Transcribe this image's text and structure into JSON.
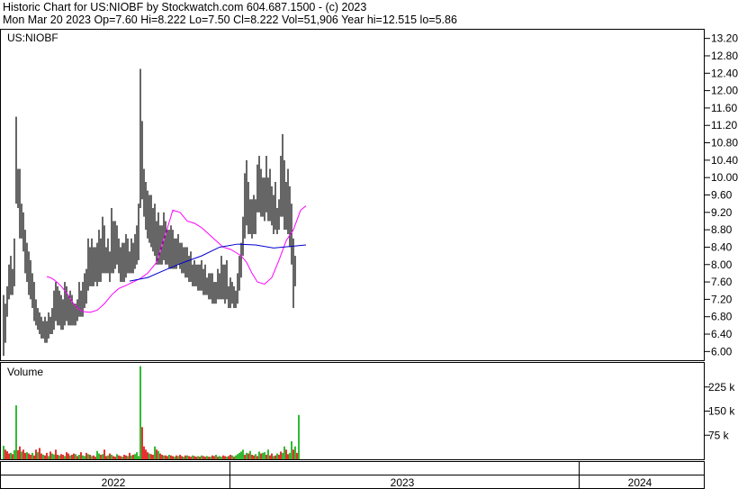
{
  "header": {
    "line1": "Historic Chart for US:NIOBF by Stockwatch.com 604.687.1500 - (c) 2023",
    "line2": "Mon Mar 20 2023   Op=7.60  Hi=8.222  Lo=7.50  Cl=8.222  Vol=51,906  Year hi=12.515  lo=5.86"
  },
  "colors": {
    "price": "#000000",
    "ma_short": "#ff00ff",
    "ma_long": "#0000cc",
    "vol_up": "#00aa00",
    "vol_down": "#dd0000",
    "frame": "#000000",
    "grid": "#c8c8c8"
  },
  "chart_data": [
    {
      "type": "line",
      "panel": "price",
      "label": "US:NIOBF",
      "yticks": [
        "13.20",
        "12.80",
        "12.40",
        "12.00",
        "11.60",
        "11.20",
        "10.80",
        "10.40",
        "10.00",
        "9.60",
        "9.20",
        "8.80",
        "8.40",
        "8.00",
        "7.60",
        "7.20",
        "6.80",
        "6.40",
        "6.00"
      ],
      "ylim": [
        5.8,
        13.4
      ],
      "grid": true,
      "series": [
        {
          "role": "price-high-low-bars",
          "x": [
            0,
            2,
            4,
            6,
            8,
            10,
            12,
            14,
            16,
            18,
            20,
            22,
            24,
            26,
            28,
            30,
            32,
            34,
            36,
            38,
            40,
            42,
            44,
            46,
            48,
            50,
            52,
            54,
            56,
            58,
            60,
            62,
            64,
            66,
            68,
            70,
            72,
            74,
            76,
            78,
            80,
            82,
            84,
            86,
            88,
            90,
            92,
            94,
            96,
            98,
            100,
            102,
            104,
            106,
            108,
            110,
            112,
            114,
            116,
            118,
            120,
            122,
            124,
            126,
            128,
            130,
            132,
            134,
            136,
            138,
            140,
            142,
            144,
            146,
            148,
            150,
            152,
            154,
            156,
            158,
            160,
            162,
            164,
            166,
            168,
            170,
            172,
            174,
            176,
            178,
            180,
            182,
            184,
            186,
            188,
            190,
            192,
            194,
            196,
            198,
            200,
            202,
            204,
            206,
            208,
            210,
            212,
            214,
            216,
            218,
            220,
            222,
            224,
            226,
            228,
            230,
            232,
            234,
            236,
            238,
            240,
            242,
            244,
            246,
            248,
            250,
            252,
            254,
            256,
            258,
            260,
            262,
            264,
            266,
            268,
            270,
            272,
            274,
            276,
            278,
            280,
            282,
            284,
            286,
            288,
            290,
            292,
            294,
            296,
            298,
            300,
            302,
            304,
            306,
            308,
            310,
            312,
            314,
            316,
            318,
            320,
            322,
            324,
            326,
            328,
            330,
            332,
            334,
            336
          ],
          "high": [
            7.3,
            7.1,
            7.5,
            8.0,
            8.2,
            7.9,
            8.6,
            11.4,
            10.2,
            10.2,
            9.4,
            9.2,
            8.8,
            8.5,
            8.3,
            8.1,
            7.8,
            7.6,
            7.2,
            7.0,
            6.9,
            6.8,
            6.7,
            6.8,
            6.7,
            6.9,
            6.8,
            7.0,
            7.4,
            7.6,
            7.5,
            7.4,
            7.3,
            7.2,
            7.6,
            7.5,
            7.3,
            7.4,
            7.3,
            7.1,
            7.1,
            7.2,
            7.6,
            7.4,
            7.6,
            7.8,
            7.9,
            8.6,
            8.4,
            8.6,
            8.4,
            8.4,
            8.5,
            8.8,
            8.6,
            9.1,
            8.9,
            8.4,
            8.6,
            8.3,
            9.3,
            9.0,
            9.0,
            8.9,
            8.6,
            8.4,
            8.5,
            8.5,
            8.7,
            8.6,
            8.3,
            8.6,
            8.5,
            8.7,
            8.9,
            9.4,
            12.5,
            11.3,
            10.2,
            9.9,
            9.7,
            9.6,
            9.6,
            9.3,
            9.4,
            9.0,
            9.2,
            8.9,
            8.9,
            9.2,
            9.0,
            8.8,
            8.8,
            8.9,
            8.8,
            8.6,
            8.6,
            8.7,
            8.5,
            8.5,
            8.4,
            8.4,
            8.4,
            8.2,
            8.3,
            8.0,
            8.1,
            8.0,
            8.0,
            8.0,
            8.1,
            7.9,
            8.0,
            7.7,
            7.8,
            7.8,
            7.8,
            7.6,
            7.6,
            7.9,
            7.8,
            8.2,
            8.0,
            8.0,
            8.1,
            7.5,
            7.7,
            7.6,
            7.5,
            7.4,
            7.8,
            8.2,
            8.5,
            9.1,
            10.1,
            10.4,
            9.9,
            9.5,
            9.5,
            9.6,
            9.5,
            10.3,
            10.5,
            10.2,
            10.0,
            10.0,
            10.5,
            10.0,
            10.2,
            9.8,
            9.6,
            9.9,
            9.3,
            9.5,
            10.5,
            11.0,
            10.4,
            9.9,
            10.2,
            9.8,
            9.4,
            8.6,
            8.2
          ],
          "low": [
            5.9,
            6.2,
            6.8,
            7.2,
            7.3,
            7.3,
            7.5,
            9.4,
            9.3,
            8.6,
            8.6,
            8.3,
            7.8,
            7.6,
            7.3,
            7.2,
            7.0,
            6.7,
            6.6,
            6.5,
            6.4,
            6.3,
            6.3,
            6.2,
            6.2,
            6.3,
            6.4,
            6.4,
            6.5,
            6.7,
            6.6,
            6.6,
            6.5,
            6.5,
            6.6,
            6.7,
            6.6,
            6.6,
            6.6,
            6.6,
            6.6,
            6.7,
            6.8,
            6.8,
            6.8,
            7.0,
            7.1,
            7.4,
            7.5,
            7.5,
            7.5,
            7.6,
            7.5,
            7.6,
            7.6,
            7.8,
            7.8,
            7.8,
            7.8,
            7.6,
            7.8,
            7.8,
            7.9,
            8.0,
            7.8,
            7.6,
            7.6,
            7.6,
            7.7,
            7.8,
            7.8,
            7.8,
            7.8,
            7.9,
            8.0,
            8.1,
            9.3,
            9.5,
            9.1,
            8.8,
            8.6,
            8.5,
            8.4,
            8.3,
            8.2,
            8.0,
            8.0,
            8.0,
            8.0,
            8.1,
            8.0,
            8.0,
            7.9,
            7.9,
            7.9,
            7.9,
            7.9,
            8.0,
            7.9,
            7.8,
            7.8,
            7.7,
            7.7,
            7.6,
            7.6,
            7.5,
            7.5,
            7.5,
            7.4,
            7.4,
            7.4,
            7.3,
            7.3,
            7.3,
            7.2,
            7.2,
            7.1,
            7.1,
            7.1,
            7.2,
            7.2,
            7.2,
            7.2,
            7.1,
            7.2,
            7.0,
            7.0,
            7.1,
            7.0,
            7.0,
            7.1,
            7.4,
            7.7,
            8.2,
            8.6,
            8.9,
            8.7,
            8.7,
            8.6,
            8.7,
            8.7,
            9.2,
            9.2,
            9.1,
            9.1,
            9.0,
            9.2,
            9.0,
            9.0,
            8.9,
            8.7,
            8.8,
            8.7,
            8.8,
            9.1,
            9.1,
            8.8,
            8.8,
            8.7,
            8.4,
            8.0,
            7.0,
            7.5
          ]
        },
        {
          "role": "moving-average-short",
          "x": [
            48,
            52,
            56,
            60,
            64,
            70,
            76,
            82,
            88,
            96,
            104,
            112,
            120,
            128,
            136,
            144,
            152,
            160,
            170,
            180,
            188,
            196,
            204,
            212,
            220,
            228,
            236,
            244,
            252,
            258,
            264,
            270,
            276,
            282,
            290,
            298,
            306,
            314,
            322,
            330,
            336
          ],
          "values": [
            7.72,
            7.7,
            7.65,
            7.58,
            7.5,
            7.35,
            7.15,
            7.0,
            6.92,
            6.9,
            6.95,
            7.1,
            7.3,
            7.45,
            7.52,
            7.6,
            7.68,
            7.8,
            8.05,
            8.7,
            9.25,
            9.2,
            9.0,
            8.95,
            8.85,
            8.7,
            8.55,
            8.4,
            8.35,
            8.28,
            8.2,
            8.05,
            7.8,
            7.6,
            7.55,
            7.7,
            8.1,
            8.55,
            8.8,
            9.25,
            9.35
          ]
        },
        {
          "role": "moving-average-long",
          "x": [
            140,
            160,
            180,
            200,
            220,
            240,
            260,
            280,
            300,
            320,
            336
          ],
          "values": [
            7.62,
            7.7,
            7.88,
            8.05,
            8.2,
            8.4,
            8.47,
            8.45,
            8.38,
            8.42,
            8.45
          ]
        }
      ]
    },
    {
      "type": "bar",
      "panel": "volume",
      "label": "Volume",
      "yticks": [
        "225 k",
        "150 k",
        "75 k"
      ],
      "ylim": [
        0,
        300
      ],
      "units": "k",
      "x": [
        0,
        2,
        4,
        6,
        8,
        10,
        12,
        14,
        16,
        18,
        20,
        22,
        24,
        26,
        28,
        30,
        32,
        34,
        36,
        38,
        40,
        42,
        44,
        46,
        48,
        50,
        52,
        54,
        56,
        58,
        60,
        62,
        64,
        66,
        68,
        70,
        72,
        74,
        76,
        78,
        80,
        82,
        84,
        86,
        88,
        90,
        92,
        94,
        96,
        98,
        100,
        102,
        104,
        106,
        108,
        110,
        112,
        114,
        116,
        118,
        120,
        122,
        124,
        126,
        128,
        130,
        132,
        134,
        136,
        138,
        140,
        142,
        144,
        146,
        148,
        150,
        152,
        154,
        156,
        158,
        160,
        162,
        164,
        166,
        168,
        170,
        172,
        174,
        176,
        178,
        180,
        182,
        184,
        186,
        188,
        190,
        192,
        194,
        196,
        198,
        200,
        202,
        204,
        206,
        208,
        210,
        212,
        214,
        216,
        218,
        220,
        222,
        224,
        226,
        228,
        230,
        232,
        234,
        236,
        238,
        240,
        242,
        244,
        246,
        248,
        250,
        252,
        254,
        256,
        258,
        260,
        262,
        264,
        266,
        268,
        270,
        272,
        274,
        276,
        278,
        280,
        282,
        284,
        286,
        288,
        290,
        292,
        294,
        296,
        298,
        300,
        302,
        304,
        306,
        308,
        310,
        312,
        314,
        316,
        318,
        320,
        322,
        324,
        326,
        328,
        330,
        332,
        334,
        336
      ],
      "values": [
        42,
        30,
        25,
        18,
        20,
        16,
        28,
        168,
        28,
        40,
        24,
        30,
        20,
        22,
        18,
        14,
        20,
        12,
        30,
        22,
        35,
        18,
        14,
        12,
        20,
        10,
        24,
        18,
        15,
        30,
        14,
        12,
        16,
        14,
        10,
        22,
        18,
        12,
        14,
        18,
        16,
        10,
        14,
        22,
        12,
        10,
        20,
        16,
        14,
        10,
        12,
        8,
        26,
        18,
        14,
        16,
        30,
        10,
        12,
        18,
        14,
        10,
        8,
        16,
        12,
        10,
        8,
        14,
        12,
        10,
        20,
        12,
        14,
        16,
        22,
        10,
        290,
        100,
        40,
        30,
        22,
        18,
        16,
        14,
        40,
        30,
        26,
        18,
        14,
        12,
        12,
        10,
        14,
        12,
        10,
        8,
        12,
        10,
        14,
        10,
        8,
        12,
        12,
        10,
        8,
        12,
        10,
        8,
        10,
        8,
        12,
        10,
        8,
        10,
        8,
        8,
        12,
        10,
        14,
        8,
        10,
        8,
        12,
        10,
        8,
        10,
        14,
        12,
        8,
        12,
        16,
        20,
        24,
        30,
        14,
        20,
        18,
        26,
        14,
        12,
        16,
        10,
        24,
        18,
        20,
        22,
        14,
        30,
        12,
        18,
        10,
        12,
        18,
        14,
        24,
        20,
        40,
        30,
        16,
        20,
        56,
        30,
        40,
        20,
        138
      ],
      "up": [
        1,
        0,
        0,
        0,
        1,
        0,
        1,
        1,
        0,
        0,
        1,
        0,
        0,
        1,
        0,
        0,
        1,
        0,
        0,
        1,
        0,
        0,
        1,
        0,
        0,
        1,
        0,
        1,
        1,
        0,
        0,
        1,
        0,
        0,
        1,
        0,
        0,
        1,
        0,
        0,
        1,
        0,
        1,
        0,
        1,
        1,
        0,
        1,
        0,
        1,
        0,
        0,
        1,
        1,
        0,
        1,
        0,
        0,
        1,
        0,
        1,
        0,
        0,
        1,
        0,
        0,
        1,
        0,
        0,
        1,
        0,
        1,
        0,
        1,
        1,
        1,
        1,
        0,
        0,
        0,
        0,
        1,
        0,
        0,
        1,
        0,
        1,
        0,
        0,
        1,
        0,
        0,
        1,
        0,
        0,
        1,
        0,
        1,
        0,
        0,
        1,
        0,
        1,
        0,
        0,
        1,
        0,
        0,
        1,
        0,
        1,
        0,
        0,
        1,
        0,
        1,
        0,
        0,
        1,
        0,
        1,
        1,
        0,
        0,
        1,
        0,
        0,
        1,
        0,
        1,
        1,
        1,
        1,
        1,
        0,
        1,
        0,
        1,
        0,
        0,
        1,
        0,
        1,
        0,
        1,
        1,
        0,
        1,
        0,
        0,
        1,
        0,
        1,
        0,
        0,
        1,
        1,
        0,
        0,
        1,
        1,
        0,
        1,
        0,
        1
      ]
    }
  ],
  "time_axis": {
    "labels": [
      "2022",
      "2023",
      "2024"
    ]
  }
}
